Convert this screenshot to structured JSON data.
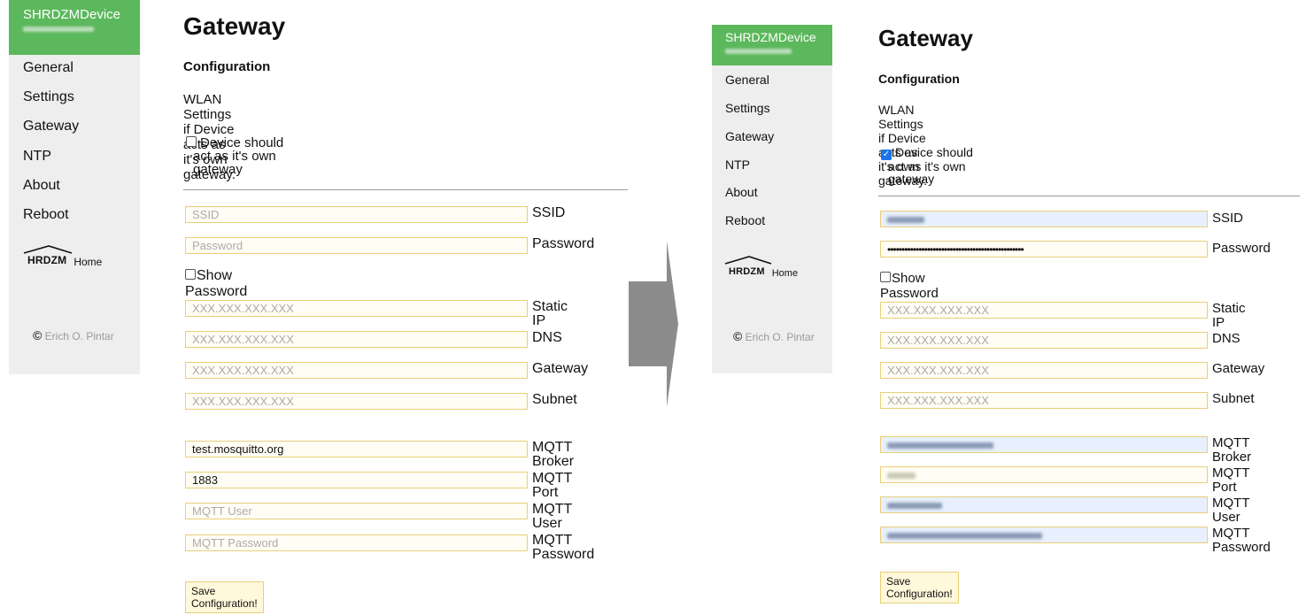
{
  "left": {
    "sidebar": {
      "title": "SHRDZMDevice",
      "items": [
        "General",
        "Settings",
        "Gateway",
        "NTP",
        "About",
        "Reboot"
      ],
      "logo_text": "HRDZM",
      "home_label": "Home",
      "copyright": "Erich O. Pintar"
    },
    "page_title": "Gateway",
    "section_title": "Configuration",
    "description": "WLAN Settings if Device acts as it's own gateway.",
    "own_gateway": {
      "checked": false,
      "label_lines": [
        "Device should",
        "act as it's own",
        "gateway"
      ]
    },
    "fields": {
      "ssid": {
        "placeholder": "SSID",
        "value": "",
        "label": "SSID"
      },
      "password": {
        "placeholder": "Password",
        "value": "",
        "label": "Password"
      },
      "show_password_label": "Show Password",
      "static_ip": {
        "placeholder": "XXX.XXX.XXX.XXX",
        "label": "Static IP"
      },
      "dns": {
        "placeholder": "XXX.XXX.XXX.XXX",
        "label": "DNS"
      },
      "gateway": {
        "placeholder": "XXX.XXX.XXX.XXX",
        "label": "Gateway"
      },
      "subnet": {
        "placeholder": "XXX.XXX.XXX.XXX",
        "label": "Subnet"
      },
      "mqtt_broker": {
        "value": "test.mosquitto.org",
        "label": "MQTT Broker"
      },
      "mqtt_port": {
        "value": "1883",
        "label": "MQTT Port"
      },
      "mqtt_user": {
        "placeholder": "MQTT User",
        "label": "MQTT User"
      },
      "mqtt_password": {
        "placeholder": "MQTT Password",
        "label_lines": [
          "MQTT",
          "Password"
        ]
      }
    },
    "save_button": "Save Configuration!"
  },
  "right": {
    "sidebar": {
      "title": "SHRDZMDevice",
      "items": [
        "General",
        "Settings",
        "Gateway",
        "NTP",
        "About",
        "Reboot"
      ],
      "logo_text": "HRDZM",
      "home_label": "Home",
      "copyright": "Erich O. Pintar"
    },
    "page_title": "Gateway",
    "section_title": "Configuration",
    "description": "WLAN Settings if Device acts as it's own gateway.",
    "own_gateway": {
      "checked": true,
      "label_lines": [
        "Device should",
        "act as it's own",
        "gateway"
      ]
    },
    "fields": {
      "ssid": {
        "label": "SSID"
      },
      "password": {
        "value": "••••••••••••••••••••••••••••••••••••••••••••••••",
        "label": "Password"
      },
      "show_password_label": "Show Password",
      "static_ip": {
        "placeholder": "XXX.XXX.XXX.XXX",
        "label": "Static IP"
      },
      "dns": {
        "placeholder": "XXX.XXX.XXX.XXX",
        "label": "DNS"
      },
      "gateway": {
        "placeholder": "XXX.XXX.XXX.XXX",
        "label": "Gateway"
      },
      "subnet": {
        "placeholder": "XXX.XXX.XXX.XXX",
        "label": "Subnet"
      },
      "mqtt_broker": {
        "label": "MQTT Broker"
      },
      "mqtt_port": {
        "label": "MQTT Port"
      },
      "mqtt_user": {
        "label": "MQTT User"
      },
      "mqtt_password": {
        "label_lines": [
          "MQTT",
          "Password"
        ]
      }
    },
    "save_button": "Save Configuration!"
  },
  "colors": {
    "header_green": "#5cb85c",
    "sidebar_bg": "#eeeeee",
    "field_border": "#e8cf7a",
    "arrow_gray": "#8c8c8c"
  },
  "icons": {
    "transition_arrow": "arrow-right-icon",
    "checkbox": "checkbox-icon",
    "copyright": "copyright-icon",
    "logo": "shrdzm-logo-icon"
  }
}
